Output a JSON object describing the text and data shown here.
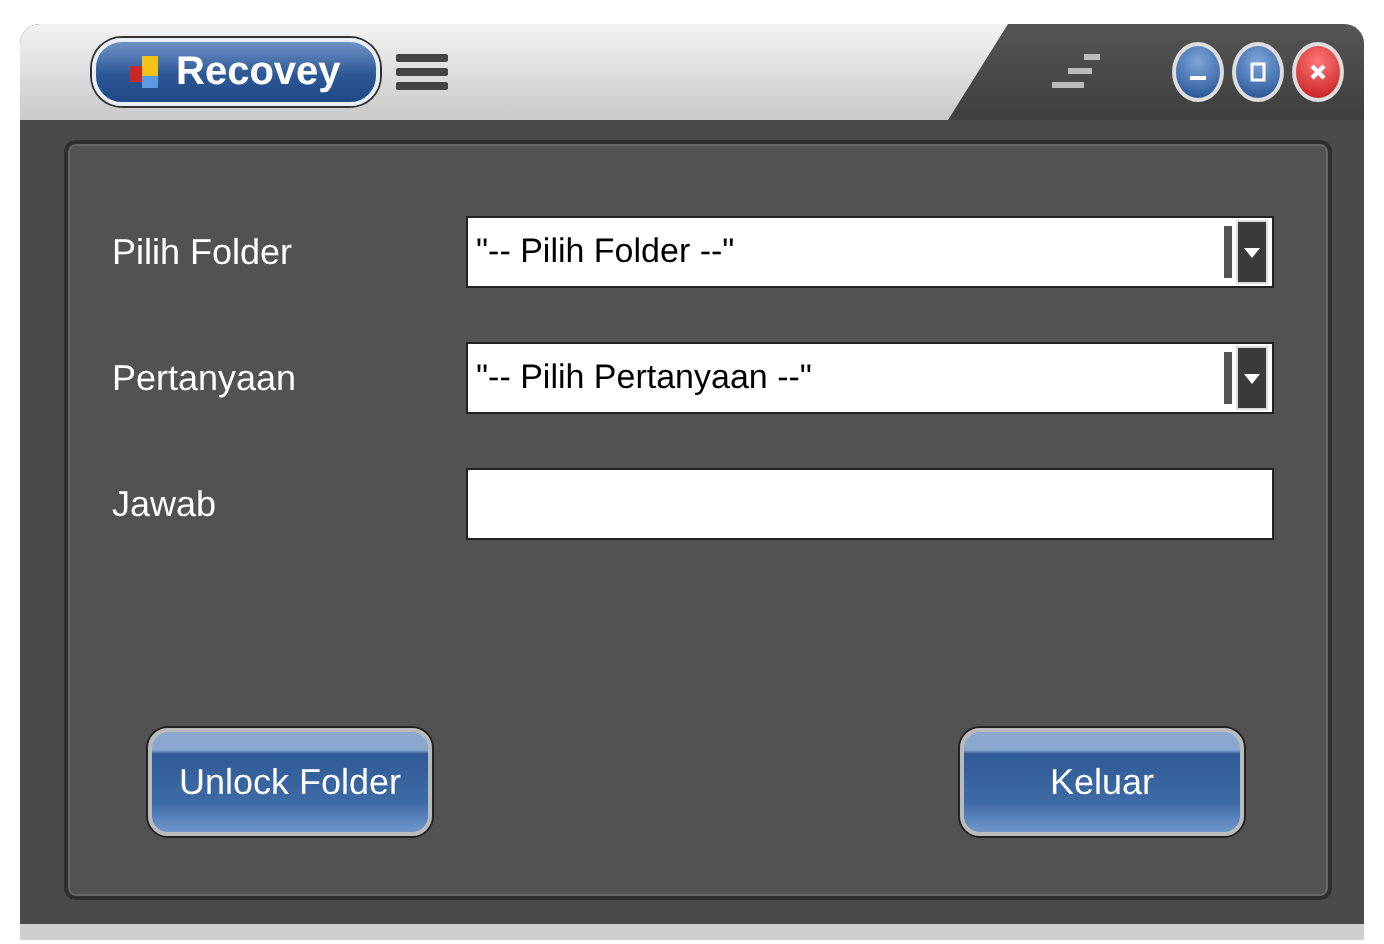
{
  "window": {
    "title": "Recovey"
  },
  "fields": [
    {
      "label": "Pilih Folder",
      "kind": "combo",
      "value": "\"-- Pilih Folder --\""
    },
    {
      "label": "Pertanyaan",
      "kind": "combo",
      "value": "\"-- Pilih Pertanyaan --\""
    },
    {
      "label": "Jawab",
      "kind": "text"
    }
  ],
  "buttons": [
    "Unlock Folder",
    "Keluar"
  ]
}
